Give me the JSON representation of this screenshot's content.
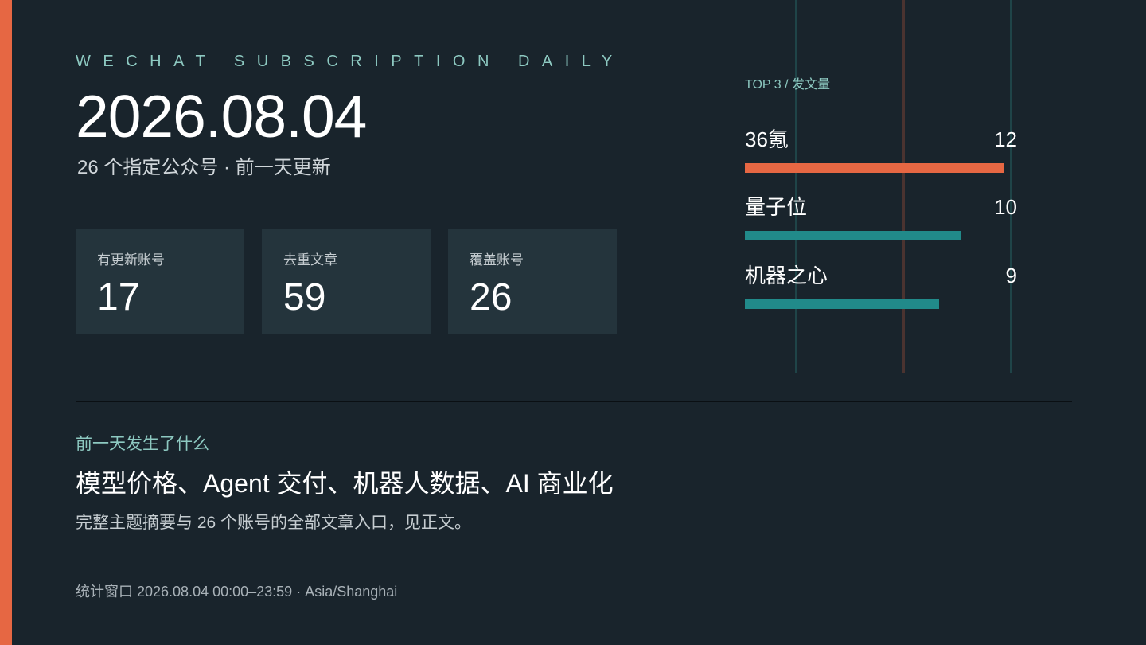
{
  "header": {
    "eyebrow": "WECHAT SUBSCRIPTION DAILY",
    "date": "2026.08.04",
    "subtitle": "26 个指定公众号 · 前一天更新"
  },
  "stats": [
    {
      "label": "有更新账号",
      "value": "17"
    },
    {
      "label": "去重文章",
      "value": "59"
    },
    {
      "label": "覆盖账号",
      "value": "26"
    }
  ],
  "ranking": {
    "title": "TOP 3 / 发文量",
    "max_scale": 12.6,
    "items": [
      {
        "name": "36氪",
        "count": 12,
        "color": "#e66743"
      },
      {
        "name": "量子位",
        "count": 10,
        "color": "#218a8a"
      },
      {
        "name": "机器之心",
        "count": 9,
        "color": "#218a8a"
      }
    ]
  },
  "summary": {
    "kicker": "前一天发生了什么",
    "headline": "模型价格、Agent 交付、机器人数据、AI 商业化",
    "description": "完整主题摘要与 26 个账号的全部文章入口，见正文。"
  },
  "footer": {
    "note": "统计窗口 2026.08.04 00:00–23:59 · Asia/Shanghai"
  },
  "colors": {
    "background": "#19242c",
    "card": "#24343c",
    "accent": "#e66743",
    "teal": "#218a8a",
    "kicker": "#8dc9c1",
    "grid_teal": "#1f4448",
    "grid_brown": "#4a3330"
  }
}
